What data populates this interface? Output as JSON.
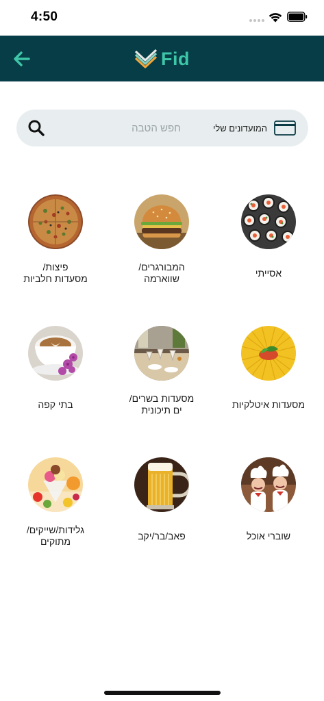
{
  "status_bar": {
    "time": "4:50"
  },
  "header": {
    "logo_text": "Fid",
    "back_icon": "arrow-left-icon",
    "colors": {
      "background": "#073d47",
      "accent": "#3ec6a8"
    }
  },
  "search": {
    "placeholder": "חפש הטבה",
    "my_clubs_label": "המועדונים שלי"
  },
  "categories": [
    {
      "label": "אסייתי",
      "icon": "sushi-image"
    },
    {
      "label": "המבורגרים/\nשווארמה",
      "icon": "burger-image"
    },
    {
      "label": "פיצות/\nמסעדות חלביות",
      "icon": "pizza-image"
    },
    {
      "label": "מסעדות איטלקיות",
      "icon": "pasta-image"
    },
    {
      "label": "מסעדות בשרים/\nים תיכונית",
      "icon": "restaurant-table-image"
    },
    {
      "label": "בתי קפה",
      "icon": "coffee-image"
    },
    {
      "label": "שוברי אוכל",
      "icon": "chefs-image"
    },
    {
      "label": "פאב/בר/יקב",
      "icon": "beer-image"
    },
    {
      "label": "גלידות/שייקים/\nמתוקים",
      "icon": "ice-cream-image"
    }
  ]
}
